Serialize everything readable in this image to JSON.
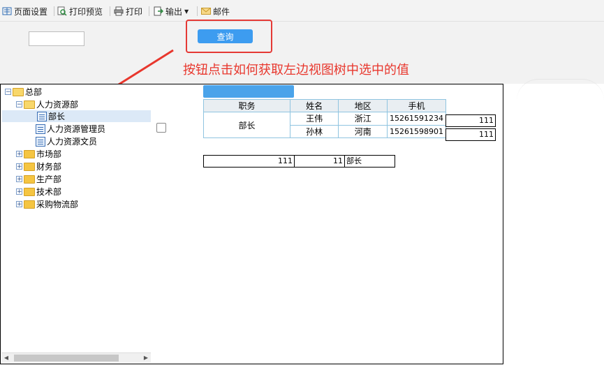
{
  "toolbar": {
    "page_setup": "页面设置",
    "print_preview": "打印预览",
    "print": "打印",
    "export": "输出",
    "mail": "邮件"
  },
  "query": {
    "input_value": "",
    "button_label": "查询"
  },
  "annotation": "按钮点击如何获取左边视图树中选中的值",
  "tree": [
    {
      "label": "总部",
      "expanded": true,
      "level": 0
    },
    {
      "label": "人力资源部",
      "expanded": true,
      "level": 1
    },
    {
      "label": "部长",
      "level": 2,
      "selected": true
    },
    {
      "label": "人力资源管理员",
      "level": 2
    },
    {
      "label": "人力资源文员",
      "level": 2
    },
    {
      "label": "市场部",
      "expanded": false,
      "level": 1
    },
    {
      "label": "财务部",
      "expanded": false,
      "level": 1
    },
    {
      "label": "生产部",
      "expanded": false,
      "level": 1
    },
    {
      "label": "技术部",
      "expanded": false,
      "level": 1
    },
    {
      "label": "采购物流部",
      "expanded": false,
      "level": 1
    }
  ],
  "report": {
    "headers": [
      "职务",
      "姓名",
      "地区",
      "手机"
    ],
    "position": "部长",
    "rows": [
      {
        "name": "王伟",
        "region": "浙江",
        "phone": "15261591234",
        "extra": "111"
      },
      {
        "name": "孙林",
        "region": "河南",
        "phone": "15261598901",
        "extra": "111"
      }
    ],
    "summary": [
      "111",
      "11",
      "部长"
    ]
  },
  "colors": {
    "accent": "#3d9cf0",
    "annotation": "#e8372d"
  }
}
